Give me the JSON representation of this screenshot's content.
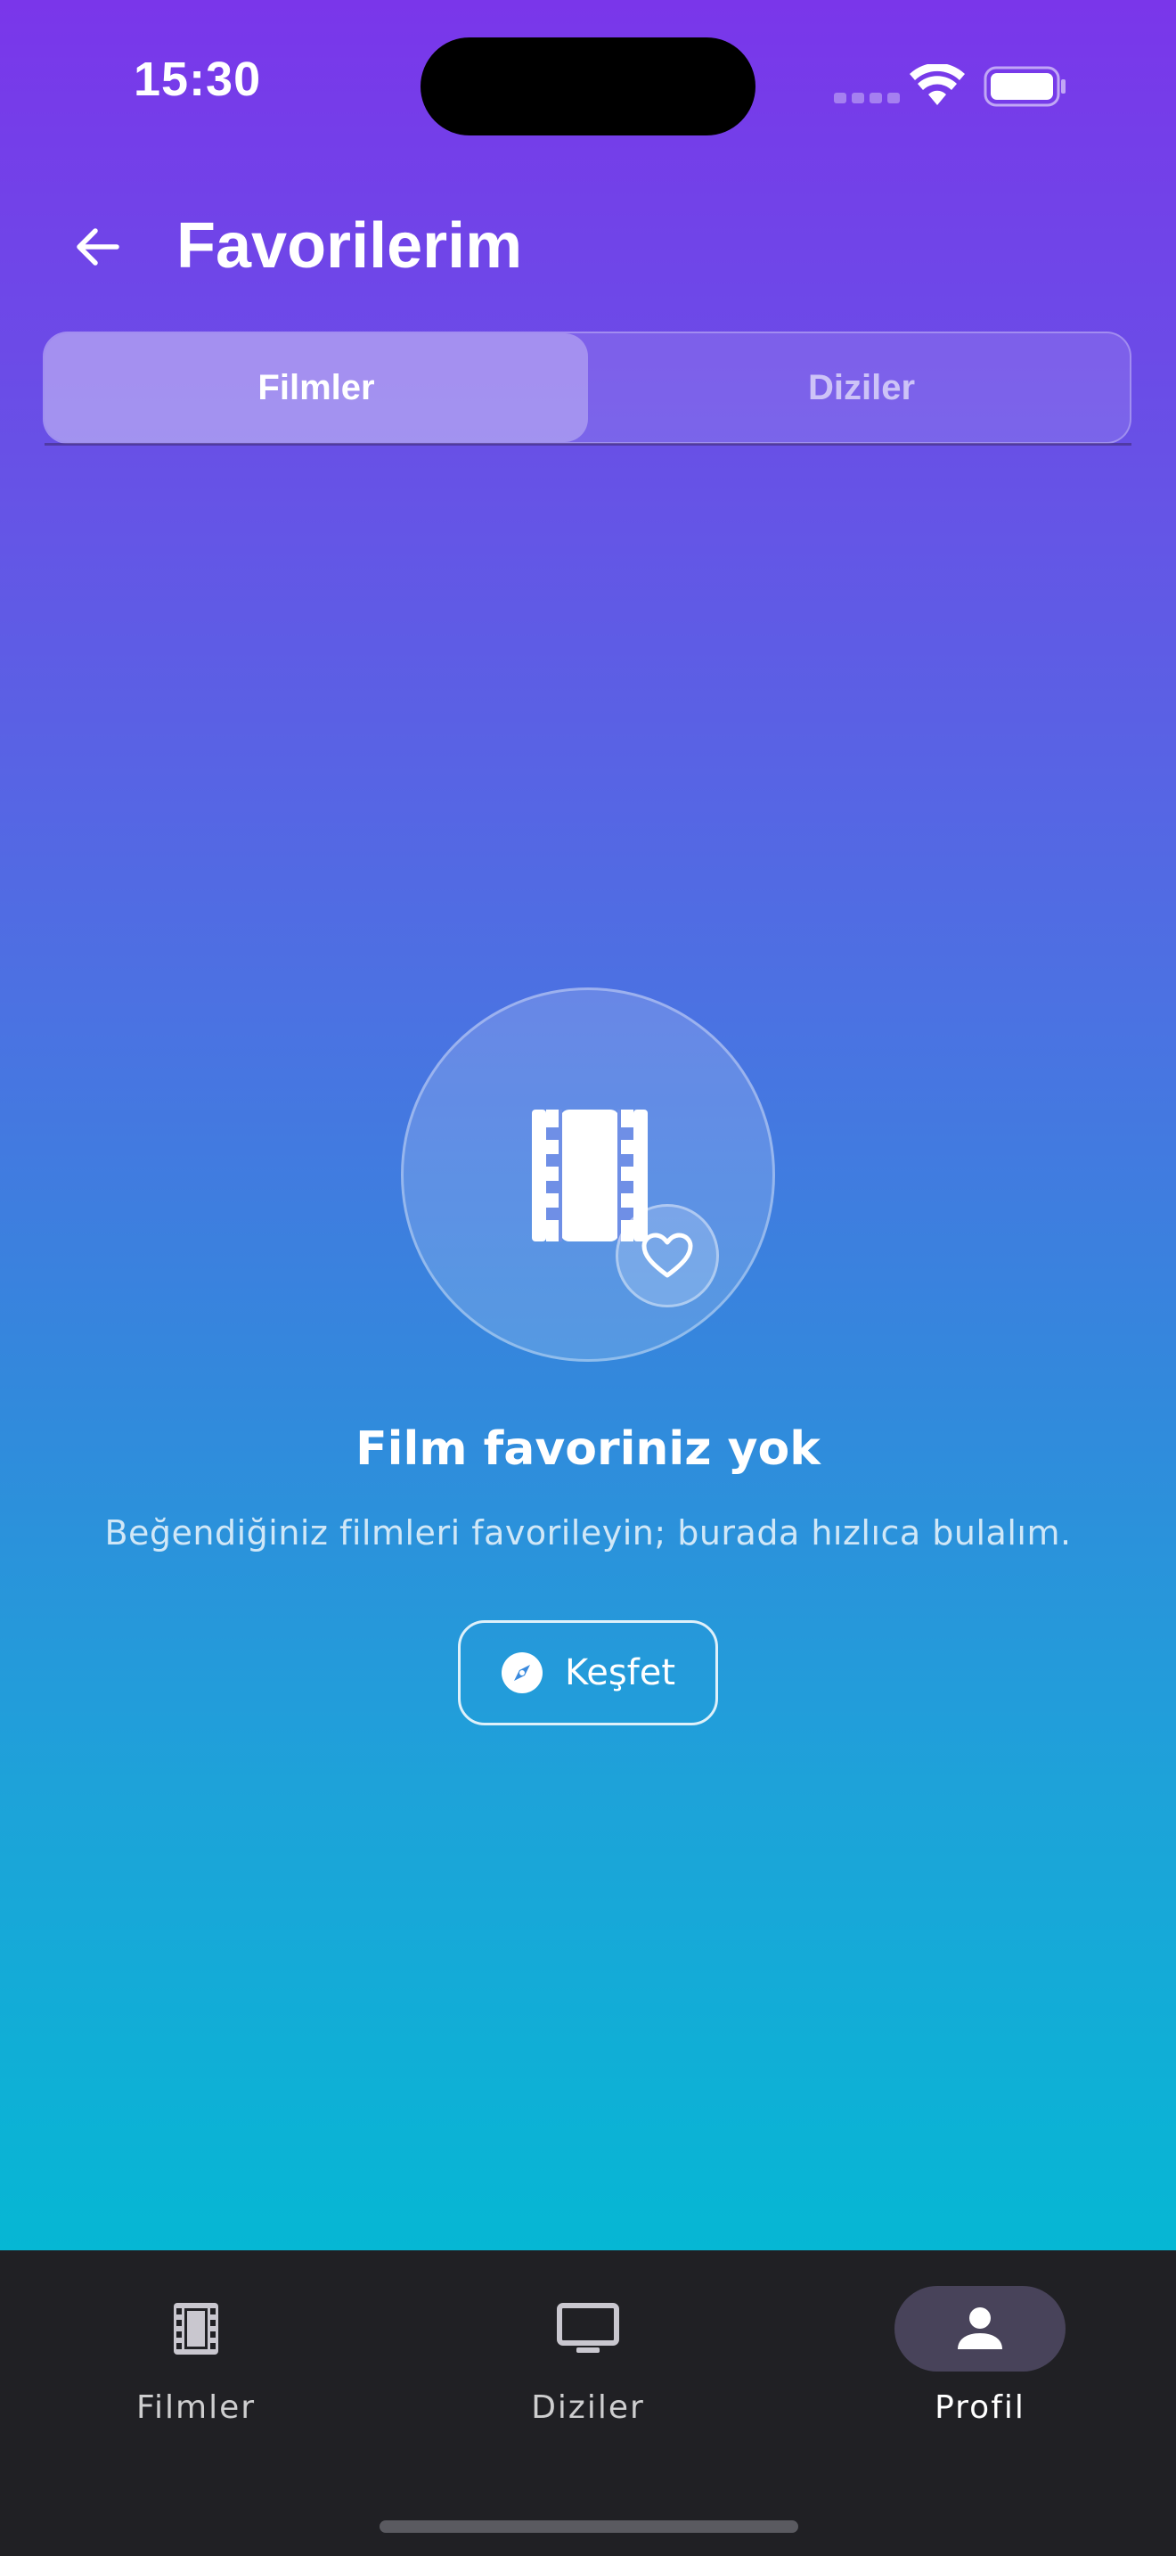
{
  "status_bar": {
    "time": "15:30"
  },
  "header": {
    "title": "Favorilerim",
    "back_icon": "arrow-left-icon"
  },
  "tabs": [
    {
      "label": "Filmler",
      "selected": true
    },
    {
      "label": "Diziler",
      "selected": false
    }
  ],
  "empty_state": {
    "icon": "movie-film-heart-icon",
    "title": "Film favoriniz yok",
    "subtitle": "Beğendiğiniz filmleri favorileyin; burada hızlıca bulalım.",
    "button_label": "Keşfet",
    "button_icon": "compass-icon"
  },
  "bottom_nav": {
    "items": [
      {
        "label": "Filmler",
        "icon": "film-icon",
        "selected": false
      },
      {
        "label": "Diziler",
        "icon": "tv-icon",
        "selected": false
      },
      {
        "label": "Profil",
        "icon": "person-icon",
        "selected": true
      }
    ]
  },
  "colors": {
    "gradient_top": "#7a36ea",
    "gradient_bottom": "#06b7d4",
    "nav_background": "#202024",
    "nav_active_pill": "#48435a"
  }
}
